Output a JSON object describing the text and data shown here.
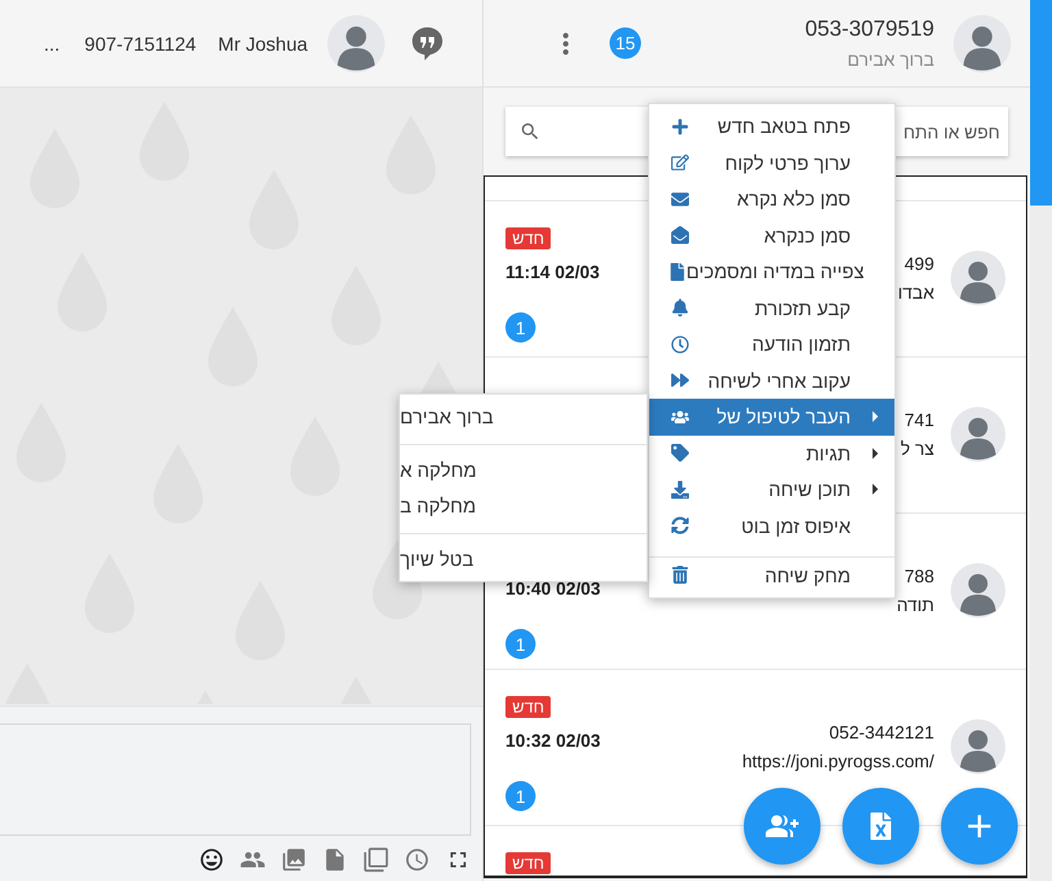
{
  "chat_header": {
    "overflow": "...",
    "phone": "907-7151124",
    "name": "Mr Joshua"
  },
  "inbox_header": {
    "unread_count": "15",
    "phone": "053-3079519",
    "name": "ברוך אבירם"
  },
  "search": {
    "placeholder": "חפש או התח"
  },
  "conversations": [
    {
      "badge": "חדש",
      "time": "11:14 02/03",
      "count": "1",
      "phone": "499",
      "name": "אבדו"
    },
    {
      "phone": "741",
      "name": "צר ל"
    },
    {
      "time": "10:40 02/03",
      "count": "1",
      "phone": "788",
      "name": "תודה"
    },
    {
      "badge": "חדש",
      "time": "10:32 02/03",
      "count": "1",
      "phone": "052-3442121",
      "name": "/https://joni.pyrogss.com"
    },
    {
      "badge": "חדש"
    }
  ],
  "context_menu": {
    "items": [
      {
        "label": "פתח בטאב חדש",
        "has_submenu": false,
        "selected": false,
        "divider_before": false
      },
      {
        "label": "ערוך פרטי לקוח",
        "has_submenu": false,
        "selected": false,
        "divider_before": false
      },
      {
        "label": "סמן כלא נקרא",
        "has_submenu": false,
        "selected": false,
        "divider_before": false
      },
      {
        "label": "סמן כנקרא",
        "has_submenu": false,
        "selected": false,
        "divider_before": false
      },
      {
        "label": "צפייה במדיה ומסמכים",
        "has_submenu": false,
        "selected": false,
        "divider_before": false
      },
      {
        "label": "קבע תזכורת",
        "has_submenu": false,
        "selected": false,
        "divider_before": false
      },
      {
        "label": "תזמון הודעה",
        "has_submenu": false,
        "selected": false,
        "divider_before": false
      },
      {
        "label": "עקוב אחרי לשיחה",
        "has_submenu": false,
        "selected": false,
        "divider_before": false
      },
      {
        "label": "העבר לטיפול של",
        "has_submenu": true,
        "selected": true,
        "divider_before": false
      },
      {
        "label": "תגיות",
        "has_submenu": true,
        "selected": false,
        "divider_before": false
      },
      {
        "label": "תוכן שיחה",
        "has_submenu": true,
        "selected": false,
        "divider_before": false
      },
      {
        "label": "איפוס זמן בוט",
        "has_submenu": false,
        "selected": false,
        "divider_before": false
      },
      {
        "label": "מחק שיחה",
        "has_submenu": false,
        "selected": false,
        "divider_before": true
      }
    ]
  },
  "submenu": {
    "items": [
      {
        "label": "ברוך אבירם",
        "divider_before": false
      },
      {
        "label": "מחלקה א",
        "divider_before": true
      },
      {
        "label": "מחלקה ב",
        "divider_before": false
      },
      {
        "label": "בטל שיוך",
        "divider_before": true
      }
    ]
  }
}
